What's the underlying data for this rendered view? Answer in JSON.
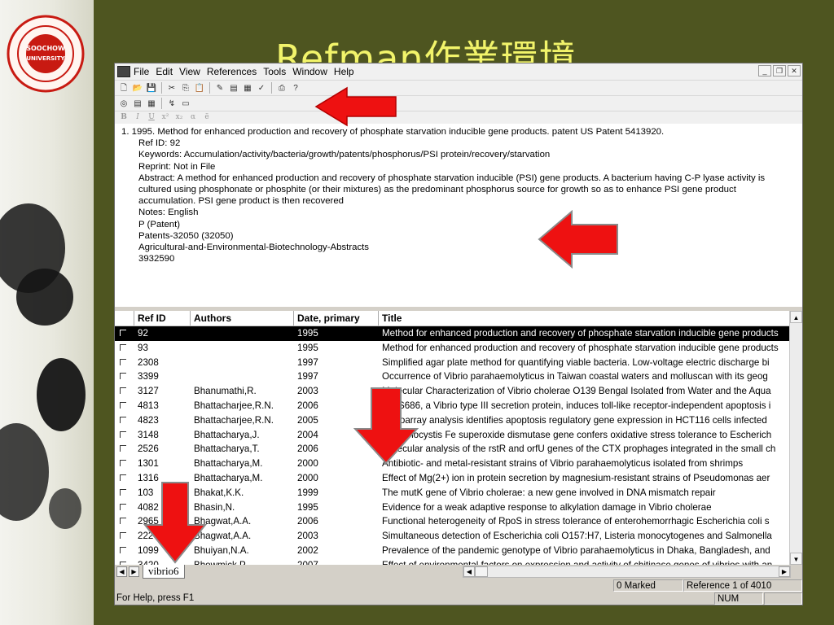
{
  "slide": {
    "title": "Refman作業環境",
    "logo_text": "SOOCHOW UNIVERSITY"
  },
  "window": {
    "menu": [
      "File",
      "Edit",
      "View",
      "References",
      "Tools",
      "Window",
      "Help"
    ],
    "controls": [
      "_",
      "ð",
      "x"
    ]
  },
  "format_toolbar": [
    "B",
    "I",
    "U",
    "x²",
    "x₂",
    "α",
    "ë"
  ],
  "detail": {
    "line1": "1.   1995. Method for enhanced production and recovery of phosphate starvation inducible gene products. patent US Patent 5413920.",
    "ref_id": "Ref ID: 92",
    "keywords": "Keywords: Accumulation/activity/bacteria/growth/patents/phosphorus/PSI protein/recovery/starvation",
    "reprint": "Reprint: Not in File",
    "abstract": "Abstract: A method for enhanced production and recovery of phosphate starvation inducible (PSI) gene products. A bacterium having C-P lyase activity is cultured using phosphonate or phosphite (or their mixtures) as the predominant phosphorus source for growth so as to enhance PSI gene product accumulation. PSI gene product is then recovered",
    "notes": "Notes: English",
    "patent": "P (Patent)",
    "patents_code": "Patents-32050 (32050)",
    "database": "Agricultural-and-Environmental-Biotechnology-Abstracts",
    "number": "3932590"
  },
  "grid": {
    "headers": [
      "Ref ID",
      "Authors",
      "Date, primary",
      "Title"
    ],
    "rows": [
      {
        "id": "92",
        "author": "",
        "year": "1995",
        "title": "Method for enhanced production and recovery of phosphate starvation inducible gene products",
        "selected": true
      },
      {
        "id": "93",
        "author": "",
        "year": "1995",
        "title": "Method for enhanced production and recovery of phosphate starvation inducible gene products"
      },
      {
        "id": "2308",
        "author": "",
        "year": "1997",
        "title": "Simplified agar plate method for quantifying viable bacteria. Low-voltage electric discharge bi"
      },
      {
        "id": "3399",
        "author": "",
        "year": "1997",
        "title": "Occurrence of Vibrio parahaemolyticus in Taiwan coastal waters and molluscan with its geog"
      },
      {
        "id": "3127",
        "author": "Bhanumathi,R.",
        "year": "2003",
        "title": "Molecular Characterization of Vibrio cholerae O139 Bengal Isolated from Water and the Aqua"
      },
      {
        "id": "4813",
        "author": "Bhattacharjee,R.N.",
        "year": "2006",
        "title": "VopS686, a Vibrio type III secretion protein, induces toll-like receptor-independent apoptosis i"
      },
      {
        "id": "4823",
        "author": "Bhattacharjee,R.N.",
        "year": "2005",
        "title": "Microarray analysis identifies apoptosis regulatory gene expression in HCT116 cells infected"
      },
      {
        "id": "3148",
        "author": "Bhattacharya,J.",
        "year": "2004",
        "title": "Synechocystis Fe superoxide dismutase gene confers oxidative stress tolerance to Escherich"
      },
      {
        "id": "2526",
        "author": "Bhattacharya,T.",
        "year": "2006",
        "title": "Molecular analysis of the rstR and orfU genes of the CTX prophages integrated in the small ch"
      },
      {
        "id": "1301",
        "author": "Bhattacharya,M.",
        "year": "2000",
        "title": "Antibiotic- and metal-resistant strains of Vibrio parahaemolyticus isolated from shrimps"
      },
      {
        "id": "1316",
        "author": "Bhattacharya,M.",
        "year": "2000",
        "title": "Effect of Mg(2+) ion in protein secretion by magnesium-resistant strains of Pseudomonas aer"
      },
      {
        "id": "103",
        "author": "Bhakat,K.K.",
        "year": "1999",
        "title": "The mutK gene of Vibrio cholerae: a new gene involved in DNA mismatch repair"
      },
      {
        "id": "4082",
        "author": "Bhasin,N.",
        "year": "1995",
        "title": "Evidence for a weak adaptive response to alkylation damage in Vibrio cholerae"
      },
      {
        "id": "2965",
        "author": "Bhagwat,A.A.",
        "year": "2006",
        "title": "Functional heterogeneity of RpoS in stress tolerance of enterohemorrhagic Escherichia coli s"
      },
      {
        "id": "2227",
        "author": "Bhagwat,A.A.",
        "year": "2003",
        "title": "Simultaneous detection of Escherichia coli O157:H7, Listeria monocytogenes and Salmonella"
      },
      {
        "id": "1099",
        "author": "Bhuiyan,N.A.",
        "year": "2002",
        "title": "Prevalence of the pandemic genotype of Vibrio parahaemolyticus in Dhaka, Bangladesh, and"
      },
      {
        "id": "3420",
        "author": "Bhowmick,P.",
        "year": "2007",
        "title": "Effect of environmental factors on expression and activity of chitinase genes of vibrios with an"
      }
    ]
  },
  "sheet_tab": "vibrio6",
  "status": {
    "marked": "0 Marked",
    "reference": "Reference 1 of 4010",
    "help": "For Help, press F1",
    "num": "NUM"
  },
  "colors": {
    "slide_bg": "#4e5520",
    "title": "#f2f46a",
    "arrow": "#ee1111",
    "selected_row": "#000000"
  }
}
